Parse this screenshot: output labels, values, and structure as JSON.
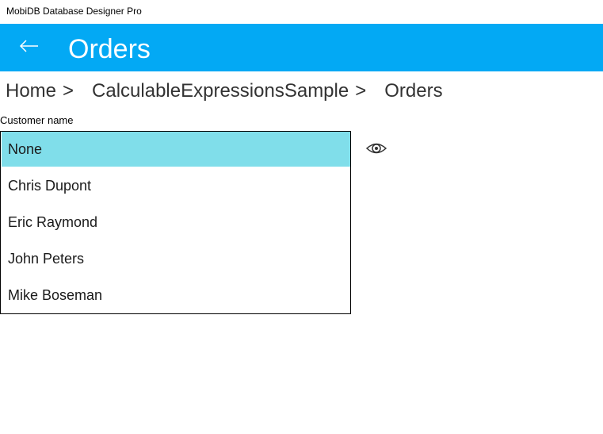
{
  "window": {
    "title": "MobiDB Database Designer Pro"
  },
  "header": {
    "title": "Orders",
    "back_icon": "back-arrow-icon",
    "background": "#03a9f4"
  },
  "breadcrumb": {
    "items": [
      {
        "label": "Home",
        "separator": ">"
      },
      {
        "label": "CalculableExpressionsSample",
        "separator": ">"
      },
      {
        "label": "Orders"
      }
    ]
  },
  "field": {
    "label": "Customer name",
    "selected_value": "None",
    "options": [
      "None",
      "Chris Dupont",
      "Eric Raymond",
      "John Peters",
      "Mike Boseman"
    ],
    "selected_color": "#80deea",
    "view_icon": "eye-icon"
  }
}
